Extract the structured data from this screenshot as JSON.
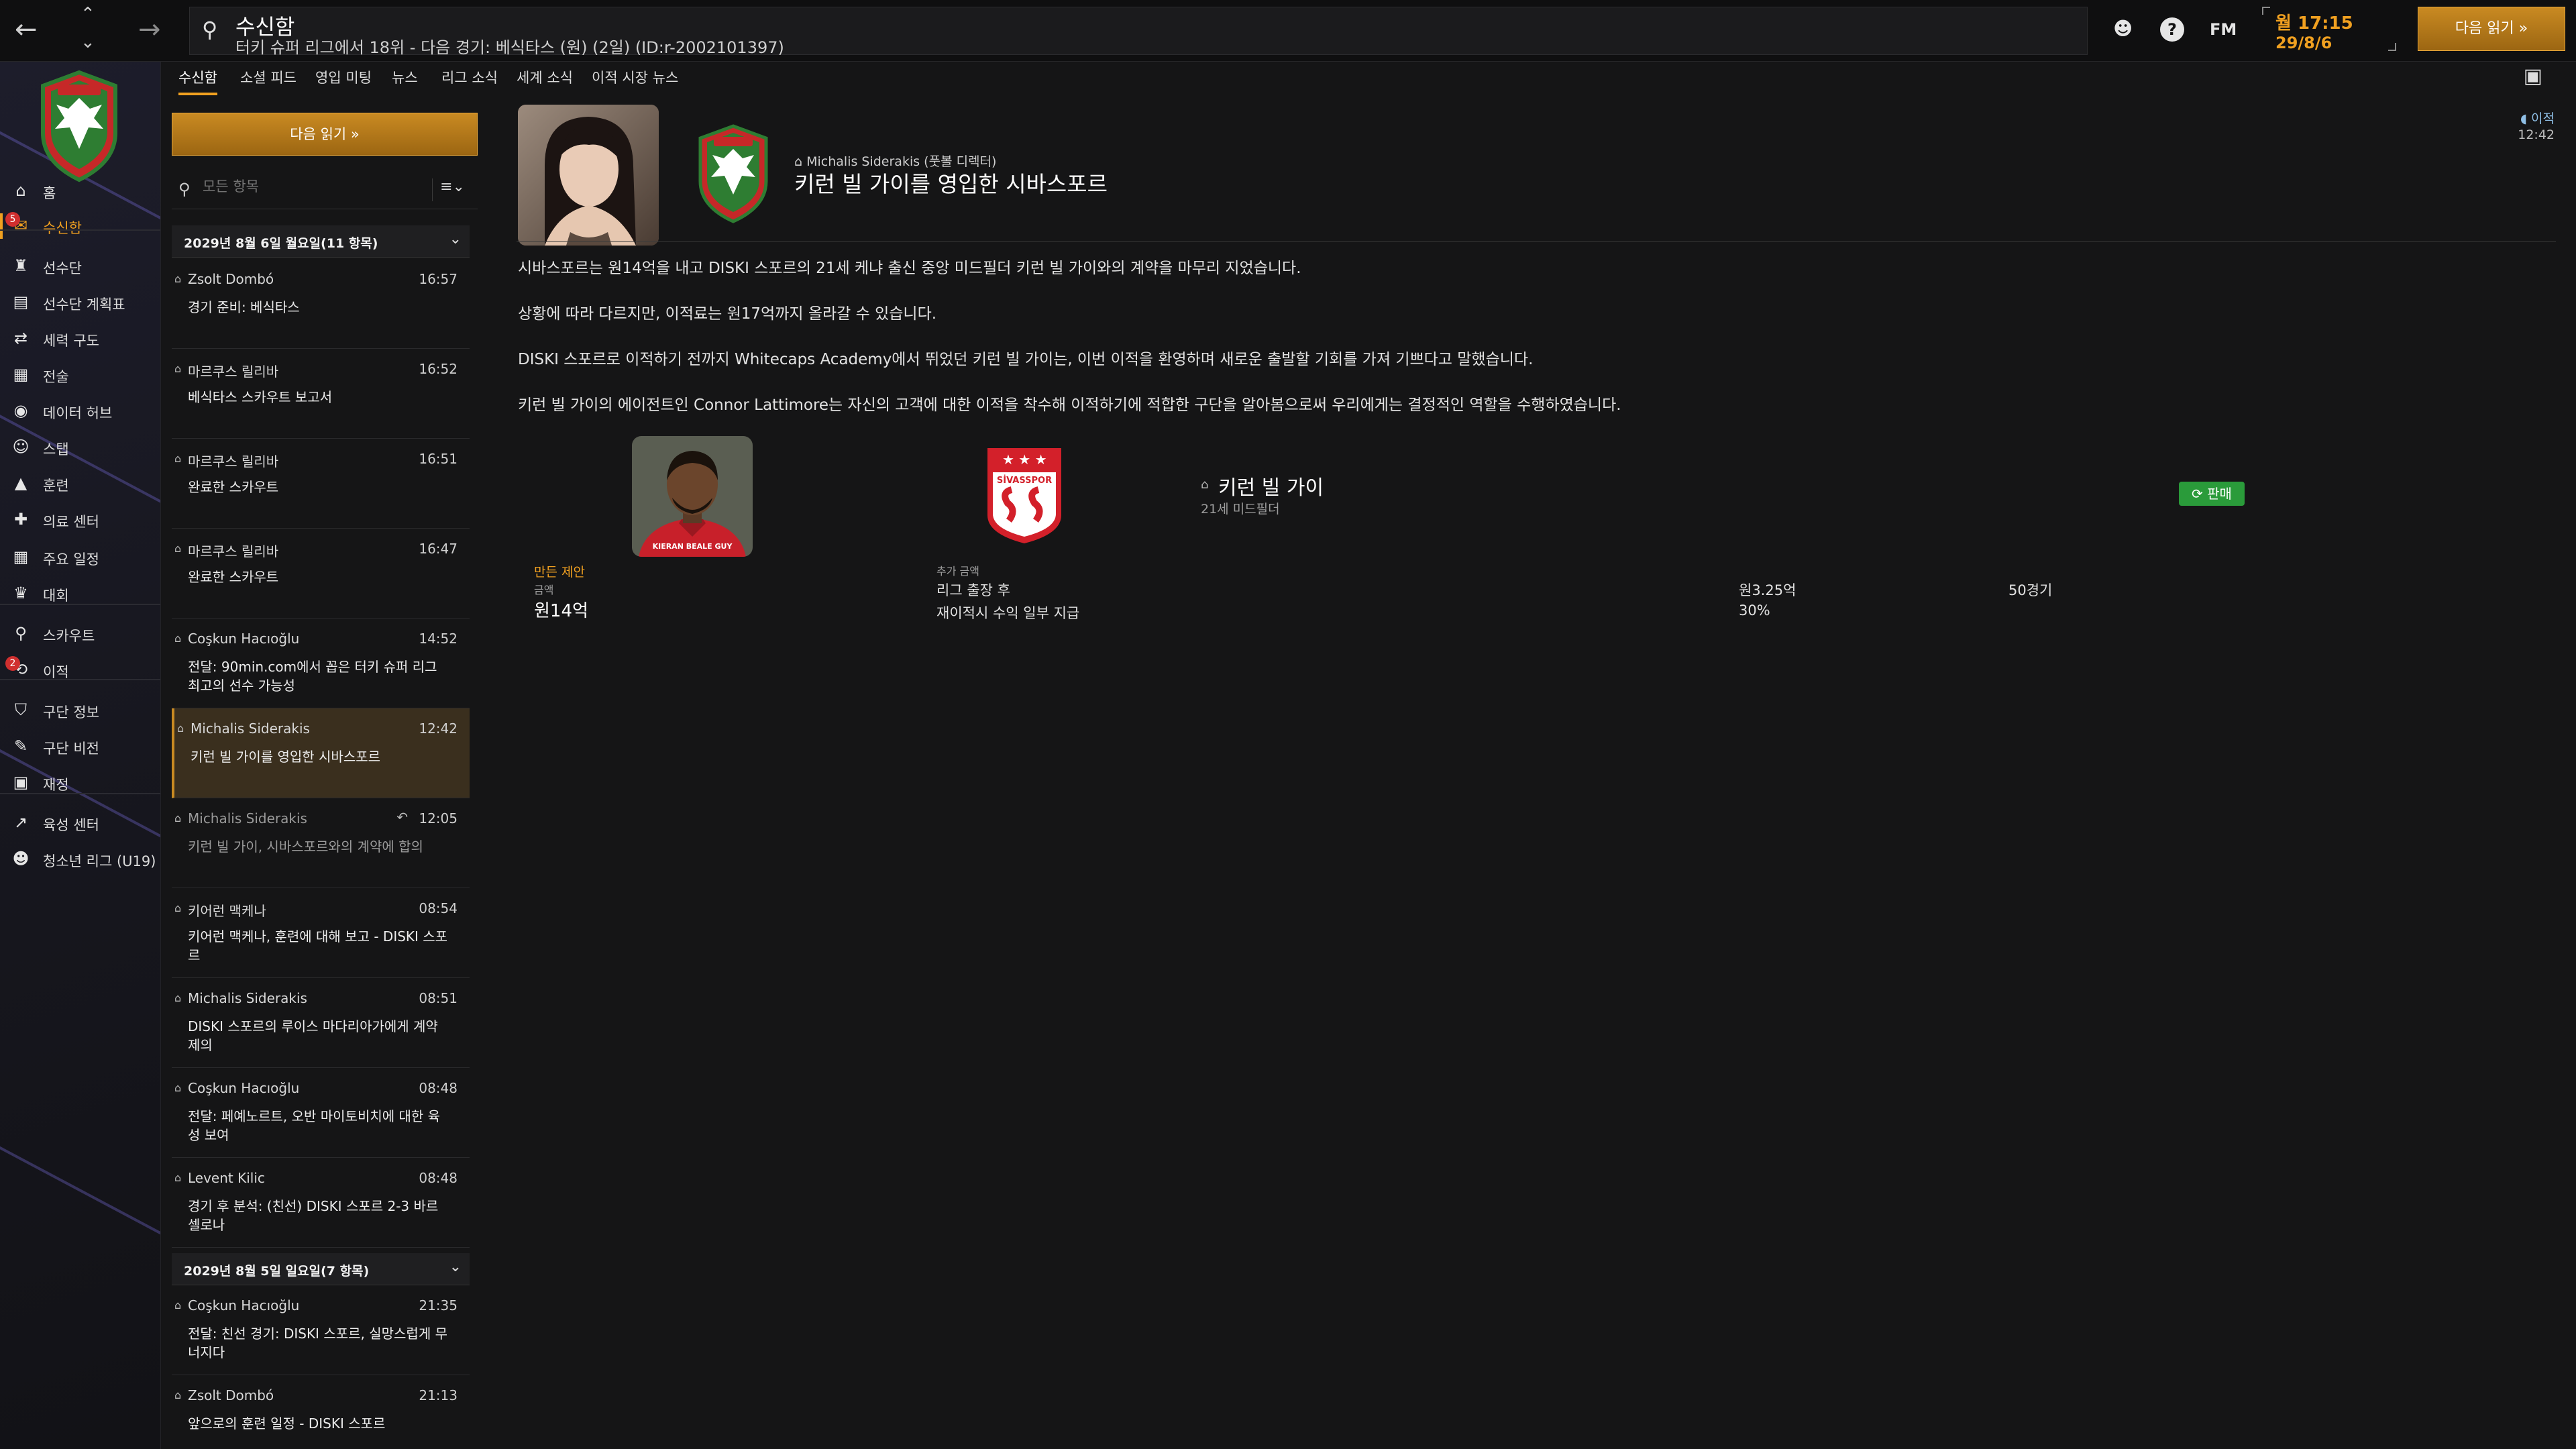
{
  "topbar": {
    "back_icon": "arrow-left-icon",
    "forward_icon": "arrow-right-icon",
    "search_title": "수신함",
    "search_subtitle": "터키 슈퍼 리그에서 18위 - 다음 경기: 베식타스 (원) (2일) (ID:r-2002101397)",
    "fm_logo": "FM",
    "date_line1": "월 17:15",
    "date_line2": "29/8/6",
    "continue_label": "다음 읽기 »"
  },
  "sidebar": {
    "items": [
      {
        "label": "홈",
        "icon": "home-icon"
      },
      {
        "label": "수신함",
        "icon": "inbox-icon",
        "badge": "5",
        "active": true
      },
      {
        "label": "선수단",
        "icon": "shirt-icon"
      },
      {
        "label": "선수단 계획표",
        "icon": "clipboard-icon"
      },
      {
        "label": "세력 구도",
        "icon": "dynamics-icon"
      },
      {
        "label": "전술",
        "icon": "tactics-icon"
      },
      {
        "label": "데이터 허브",
        "icon": "data-hub-icon"
      },
      {
        "label": "스탭",
        "icon": "staff-icon"
      },
      {
        "label": "훈련",
        "icon": "training-icon"
      },
      {
        "label": "의료 센터",
        "icon": "medical-icon"
      },
      {
        "label": "주요 일정",
        "icon": "calendar-icon"
      },
      {
        "label": "대회",
        "icon": "trophy-icon"
      },
      {
        "label": "스카우트",
        "icon": "scout-icon"
      },
      {
        "label": "이적",
        "icon": "transfer-icon",
        "badge": "2"
      },
      {
        "label": "구단 정보",
        "icon": "shield-icon"
      },
      {
        "label": "구단 비전",
        "icon": "vision-icon"
      },
      {
        "label": "재정",
        "icon": "finance-icon"
      },
      {
        "label": "육성 센터",
        "icon": "development-icon"
      },
      {
        "label": "청소년 리그 (U19)",
        "icon": "youth-icon"
      }
    ]
  },
  "tabs": [
    "수신함",
    "소셜 피드",
    "영입 미팅",
    "뉴스",
    "리그 소식",
    "세계 소식",
    "이적 시장 뉴스"
  ],
  "inbox": {
    "read_next_label": "다음 읽기 »",
    "filter_placeholder": "모든 항목",
    "sort_label": "≡⌄",
    "day1": "2029년 8월 6일 월요일(11 항목)",
    "day2": "2029년 8월 5일 일요일(7 항목)",
    "messages": [
      {
        "sender": "Zsolt Dombó",
        "time": "16:57",
        "subject": "경기 준비: 베식타스"
      },
      {
        "sender": "마르쿠스 릴리바",
        "time": "16:52",
        "subject": "베식타스 스카우트 보고서"
      },
      {
        "sender": "마르쿠스 릴리바",
        "time": "16:51",
        "subject": "완료한 스카우트"
      },
      {
        "sender": "마르쿠스 릴리바",
        "time": "16:47",
        "subject": "완료한 스카우트"
      },
      {
        "sender": "Coşkun Hacıoğlu",
        "time": "14:52",
        "subject": "전달: 90min.com에서 꼽은 터키 슈퍼 리그 최고의 선수 가능성"
      },
      {
        "sender": "Michalis Siderakis",
        "time": "12:42",
        "subject": "키런 빌 가이를 영입한 시바스포르"
      },
      {
        "sender": "Michalis Siderakis",
        "time": "12:05",
        "subject": "키런 빌 가이, 시바스포르와의 계약에 합의"
      },
      {
        "sender": "키어런 맥케나",
        "time": "08:54",
        "subject": "키어런 맥케나, 훈련에 대해 보고 - DISKI 스포르"
      },
      {
        "sender": "Michalis Siderakis",
        "time": "08:51",
        "subject": "DISKI 스포르의 루이스 마다리아가에게 계약 제의"
      },
      {
        "sender": "Coşkun Hacıoğlu",
        "time": "08:48",
        "subject": "전달: 페예노르트, 오반 마이토비치에 대한 육성 보여"
      },
      {
        "sender": "Levent Kilic",
        "time": "08:48",
        "subject": "경기 후 분석: (친선) DISKI 스포르 2-3 바르셀로나"
      },
      {
        "sender": "Coşkun Hacıoğlu",
        "time": "21:35",
        "subject": "전달: 친선 경기: DISKI 스포르, 실망스럽게 무너지다"
      },
      {
        "sender": "Zsolt Dombó",
        "time": "21:13",
        "subject": "앞으로의 훈련 일정 - DISKI 스포르"
      }
    ]
  },
  "message": {
    "author": "Michalis Siderakis (풋볼 디렉터)",
    "title": "키런 빌 가이를 영입한 시바스포르",
    "tag": "이적",
    "time": "12:42",
    "paragraphs": [
      "시바스포르는 원14억을 내고 DISKI 스포르의 21세 케냐 출신 중앙 미드필더 키런 빌 가이와의 계약을 마무리 지었습니다.",
      "상황에 따라 다르지만, 이적료는 원17억까지 올라갈 수 있습니다.",
      "DISKI 스포르로 이적하기 전까지 Whitecaps Academy에서 뛰었던 키런 빌 가이는, 이번 이적을 환영하며 새로운 출발할 기회를 가져 기쁘다고 말했습니다.",
      "키런 빌 가이의 에이전트인 Connor Lattimore는 자신의 고객에 대한 이적을 착수해 이적하기에 적합한 구단을 알아봄으로써 우리에게는 결정적인 역할을 수행하였습니다."
    ],
    "player": {
      "name": "키런 빌 가이",
      "description": "21세 미드필더",
      "sale_tag": "판매",
      "shirt_text": "KIERAN BEALE GUY"
    },
    "club_crest_text": "SİVASSPOR",
    "fee": {
      "label": "만든 제안",
      "sub": "금액",
      "value": "원14억"
    },
    "extras": {
      "label": "추가 금액",
      "rows": [
        {
          "condition": "리그 출장 후",
          "amount": "원3.25억",
          "note": "50경기"
        },
        {
          "condition": "재이적시 수익 일부 지급",
          "amount": "30%",
          "note": ""
        }
      ]
    }
  },
  "colors": {
    "accent": "#f0a020",
    "sale_green": "#2a9b3a",
    "background": "#151516"
  }
}
